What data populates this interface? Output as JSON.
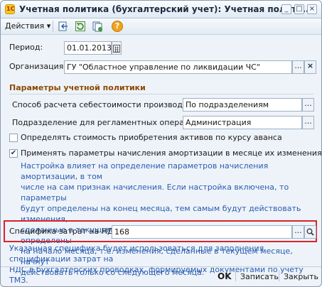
{
  "window": {
    "title": "Учетная политика (бухгалтерский учет): Учетная полити...:",
    "controls": {
      "minimize": "_",
      "maximize": "□",
      "close": "×"
    }
  },
  "toolbar": {
    "actions_label": "Действия",
    "actions_arrow": "▾",
    "icons": [
      "go-back-icon",
      "refresh-icon",
      "copy-icon",
      "help-icon"
    ],
    "help_glyph": "?"
  },
  "form": {
    "period_label": "Период:",
    "period_value": "01.01.2013",
    "org_label": "Организация:",
    "org_value": "ГУ \"Областное управление по ликвидации ЧС\"",
    "section_title": "Параметры учетной политики",
    "cost_method_label": "Способ расчета себестоимости производства:",
    "cost_method_value": "По подразделениям",
    "dept_label": "Подразделение для регламентных операций:",
    "dept_value": "Администрация",
    "advance_rate_label": "Определять стоимость приобретения активов по курсу аванса",
    "advance_rate_checked": false,
    "depreciation_label": "Применять параметры начисления амортизации в месяце их изменения",
    "depreciation_checked": true,
    "depreciation_note": [
      "Настройка влияет на определение параметров  начисления амортизации, в том",
      "числе на сам признак начисления. Если настройка включена, то параметры",
      "будут определены на конец месяца, тем самым будут действовать изменения,",
      "сделанные в текущем месяце, если отключена, то параметры будут определены",
      "на начало месяца, т.е. изменения, сделанные в текущем месяце, начнут",
      "действовать только со следующего месяца."
    ],
    "vat_cost_label": "Специфика затрат на НДС:",
    "vat_cost_value": "168",
    "vat_note": [
      "Указанная специфика будет использоваться для заполнения спецификации затрат на",
      "НДС в бухгалтерских проводках, формируемых документами по учету ТМЗ."
    ],
    "dots": "...",
    "clear": "×",
    "check_glyph": "✔"
  },
  "buttons": {
    "ok": "OK",
    "write": "Записать",
    "close": "Закрыть"
  },
  "colors": {
    "accent_section": "#8d4a00",
    "note_text": "#2a5db0",
    "highlight_border": "#d8232a"
  }
}
